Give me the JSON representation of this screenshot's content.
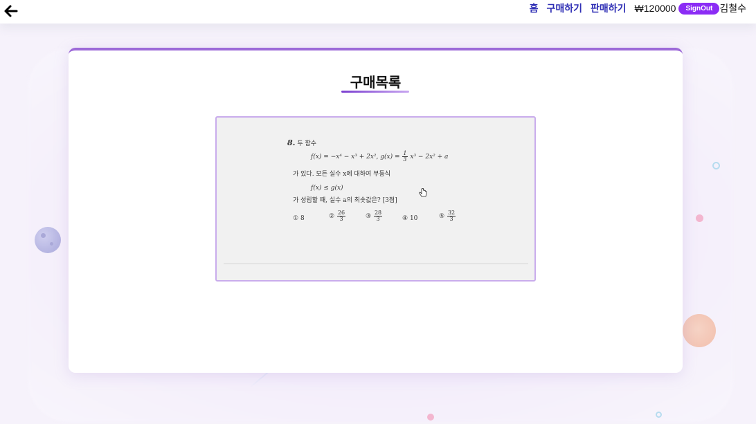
{
  "header": {
    "nav": {
      "home": "홈",
      "purchase": "구매하기",
      "sell": "판매하기",
      "balance": "₩120000",
      "signout": "SignOut",
      "username": "김철수"
    }
  },
  "main": {
    "title": "구매목록",
    "items": [
      {
        "question": {
          "number": "8.",
          "intro": "두 함수",
          "func_f": "f(x) = −x⁴ − x³ + 2x²,",
          "func_g_prefix": "g(x) =",
          "func_g_frac_num": "1",
          "func_g_frac_den": "3",
          "func_g_rest": "x³ − 2x² + a",
          "line2": "가 있다. 모든 실수 x에 대하여 부등식",
          "inequality": "f(x) ≤ g(x)",
          "line3": "가 성립할 때, 실수 a의 최솟값은? [3점]",
          "choices": [
            {
              "marker": "①",
              "value": "8"
            },
            {
              "marker": "②",
              "num": "26",
              "den": "3"
            },
            {
              "marker": "③",
              "num": "28",
              "den": "3"
            },
            {
              "marker": "④",
              "value": "10"
            },
            {
              "marker": "⑤",
              "num": "32",
              "den": "3"
            }
          ]
        }
      }
    ]
  },
  "colors": {
    "nav_link": "#2f2fb5",
    "signout_bg": "#8b2cf5",
    "card_top_border": "#9d6ad8",
    "item_border": "#c9acec"
  }
}
